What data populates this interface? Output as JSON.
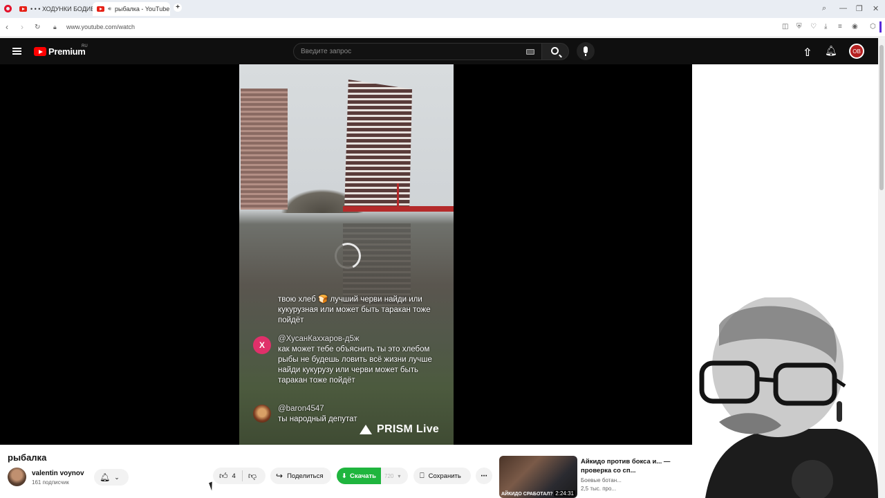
{
  "browser": {
    "tabs": [
      {
        "label": "• • • ХОДУНКИ БОДИБ"
      },
      {
        "label": "рыбалка - YouTube"
      }
    ],
    "new_tab": "+",
    "url": "www.youtube.com/watch"
  },
  "header": {
    "brand": "Premium",
    "region": "RU",
    "search_placeholder": "Введите запрос",
    "avatar_initials": "OB"
  },
  "player": {
    "overlay_chat": [
      {
        "name": "",
        "text": "твою хлеб 🍞 лучший черви найди или кукурузная или может быть таракан тоже пойдёт"
      },
      {
        "name": "@ХусанКаххаров-д5ж",
        "avatar": "X",
        "text": "как может тебе объяснить ты это хлебом рыбы не будешь ловить всё жизни лучше найди кукурузу или черви может быть таракан тоже пойдёт"
      },
      {
        "name": "@baron4547",
        "text": "ты народный депутат"
      }
    ],
    "watermark": "PRISM Live"
  },
  "video": {
    "title": "рыбалка",
    "channel": "valentin voynov",
    "subscribers": "161 подписчик",
    "likes": "4",
    "share_label": "Поделиться",
    "download_label": "Скачать",
    "download_quality": "720",
    "save_label": "Сохранить"
  },
  "recommended": {
    "title": "Айкидо против бокса и... — проверка со сп...",
    "channel": "Боевые ботан...",
    "meta": "2,5 тыс. про...",
    "thumb_caption": "АЙКИДО СРАБОТАЛ?",
    "duration": "2:24:31"
  },
  "colors": {
    "yt_red": "#ff0000",
    "download_green": "#1fb53e",
    "chat_avatar_pink": "#e0306a"
  }
}
